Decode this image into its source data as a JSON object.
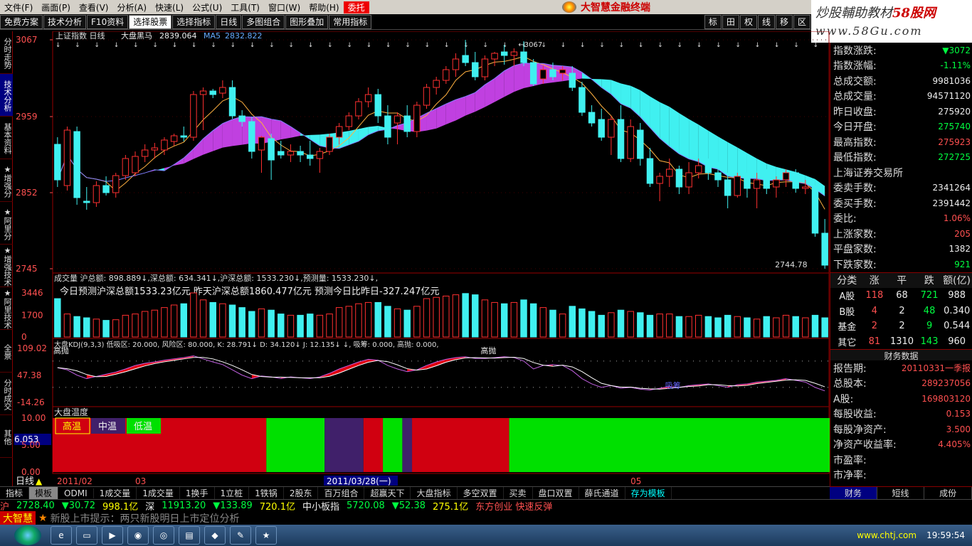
{
  "menu": [
    "文件(F)",
    "画面(P)",
    "查看(V)",
    "分析(A)",
    "快速(L)",
    "公式(U)",
    "工具(T)",
    "窗口(W)",
    "帮助(H)",
    "委托"
  ],
  "brand": "大智慧金融终端",
  "watermark": {
    "line1_prefix": "炒股輔助教材",
    "line1_accent": "58股网",
    "line2": "www.58Gu.com"
  },
  "toolbar": [
    "免费方案",
    "技术分析",
    "F10资料",
    "选择股票",
    "选择指标",
    "日线",
    "多图组合",
    "图形叠加",
    "常用指标",
    "标",
    "田",
    "权",
    "线",
    "移",
    "区"
  ],
  "side_tabs": [
    "分时走势",
    "技术分析",
    "基本资料",
    "★增强分",
    "★阿里分",
    "★增强技术",
    "★阿里技术",
    "全景",
    "分时成交",
    "其他"
  ],
  "main_chart": {
    "title": "上证指数 日线",
    "indicator": "大盘黑马",
    "indicator_value": "2839.064",
    "ma_label": "MA5",
    "ma_value": "2832.822",
    "y_ticks": [
      "3067",
      "2959",
      "2852",
      "2745"
    ],
    "low_mark": "2744.78",
    "high_mark": "3067"
  },
  "volume_panel": {
    "header": "成交量 沪总额: 898.889↓,深总额: 634.341↓,沪深总额: 1533.230↓,预测量: 1533.230↓,",
    "forecast": "今日预测沪深总额1533.23亿元  昨天沪深总额1860.477亿元  预测今日比昨日-327.247亿元",
    "y_ticks": [
      "3446",
      "1700",
      "0"
    ]
  },
  "kdj_panel": {
    "header": "大盘KDJ(9,3,3)  低吸区: 20.000, 风险区: 80.000, K: 28.791↓ D: 34.120↓ J: 12.135↓  ↓,  吸筹: 0.000, 高抛: 0.000,",
    "y_ticks": [
      "109.02",
      "47.38",
      "-14.26"
    ],
    "labels": [
      "高抛",
      "高抛",
      "吸筹"
    ]
  },
  "temp_panel": {
    "title": "大盘温度",
    "legend": [
      "高温",
      "中温",
      "低温"
    ],
    "y_ticks": [
      "10.00",
      "6.053",
      "5.00",
      "0.00"
    ]
  },
  "date_axis": {
    "left": "2011/02",
    "m3": "03",
    "cursor": "2011/03/28(一)",
    "m5": "05"
  },
  "period_label": "日线",
  "right_panel": [
    {
      "k": "指数涨跌:",
      "v": "▼3072",
      "c": "grn"
    },
    {
      "k": "指数涨幅:",
      "v": "-1.11%",
      "c": "grn"
    },
    {
      "k": "总成交额:",
      "v": "9981036",
      "c": "wht"
    },
    {
      "k": "总成交量:",
      "v": "94571120",
      "c": "wht"
    },
    {
      "k": "昨日收盘:",
      "v": "275920",
      "c": "wht"
    },
    {
      "k": "今日开盘:",
      "v": "275740",
      "c": "grn"
    },
    {
      "k": "最高指数:",
      "v": "275923",
      "c": "red"
    },
    {
      "k": "最低指数:",
      "v": "272725",
      "c": "grn"
    },
    {
      "k": "上海证券交易所",
      "v": "",
      "c": "wht"
    },
    {
      "k": "委卖手数:",
      "v": "2341264",
      "c": "wht"
    },
    {
      "k": "委买手数:",
      "v": "2391442",
      "c": "wht"
    },
    {
      "k": "委比:",
      "v": "1.06%",
      "c": "red"
    },
    {
      "k": "上涨家数:",
      "v": "205",
      "c": "red"
    },
    {
      "k": "平盘家数:",
      "v": "1382",
      "c": "wht"
    },
    {
      "k": "下跌家数:",
      "v": "921",
      "c": "grn"
    }
  ],
  "class_table": {
    "headers": [
      "分类",
      "涨",
      "平",
      "跌",
      "额(亿)"
    ],
    "rows": [
      [
        "A股",
        "118",
        "68",
        "721",
        "988"
      ],
      [
        "B股",
        "4",
        "2",
        "48",
        "0.340"
      ],
      [
        "基金",
        "2",
        "2",
        "9",
        "0.544"
      ],
      [
        "其它",
        "81",
        "1310",
        "143",
        "960"
      ]
    ]
  },
  "finance": {
    "title": "财务数据",
    "rows": [
      {
        "k": "报告期:",
        "v": "20110331一季报",
        "c": "red"
      },
      {
        "k": "总股本:",
        "v": "289237056",
        "c": "red"
      },
      {
        "k": "A股:",
        "v": "169803120",
        "c": "red"
      },
      {
        "k": "每股收益:",
        "v": "0.153",
        "c": "red"
      },
      {
        "k": "每股净资产:",
        "v": "3.500",
        "c": "red"
      },
      {
        "k": "净资产收益率:",
        "v": "4.405%",
        "c": "red"
      },
      {
        "k": "市盈率:",
        "v": "",
        "c": "wht"
      },
      {
        "k": "市净率:",
        "v": "",
        "c": "wht"
      }
    ]
  },
  "right_tabs": [
    "财务",
    "短线",
    "成份"
  ],
  "bottom_tabs": [
    "指标",
    "模板",
    "ODMI",
    "1成交量",
    "1成交量",
    "1换手",
    "1立桩",
    "1铁锅",
    "2股东",
    "百万组合",
    "超赢天下",
    "大盘指标",
    "多空双置",
    "买卖",
    "盘口双置",
    "薛氏通道",
    "存为模板"
  ],
  "ticker": {
    "sh_label": "沪",
    "sh_val": "2728.40",
    "sh_chg": "▼30.72",
    "sh_amt": "998.1亿",
    "sz_label": "深",
    "sz_val": "11913.20",
    "sz_chg": "▼133.89",
    "sz_amt": "720.1亿",
    "zxb_label": "中小板指",
    "zxb_val": "5720.08",
    "zxb_chg": "▼52.38",
    "zxb_amt": "275.1亿",
    "promo": "东方创业 快速反弹"
  },
  "news": {
    "app": "大智慧",
    "text": "新股上市提示：两只新股明日上市定位分析"
  },
  "taskbar": {
    "time": "19:59:54",
    "site": "www.chtj.com"
  },
  "colors": {
    "up": "#ff3030",
    "down": "#40f0f0",
    "ma_up": "#c040e0",
    "band_down": "#40f0f0",
    "hot": "#d00010",
    "warm": "#40206a",
    "cold": "#00e000"
  },
  "chart_data": {
    "type": "candlestick",
    "title": "上证指数 日线",
    "ylim": [
      2745,
      3067
    ],
    "ohlc": [
      [
        2920,
        2930,
        2860,
        2870
      ],
      [
        2862,
        2945,
        2855,
        2940
      ],
      [
        2938,
        2945,
        2835,
        2845
      ],
      [
        2840,
        2860,
        2828,
        2838
      ],
      [
        2838,
        2868,
        2832,
        2862
      ],
      [
        2862,
        2875,
        2848,
        2852
      ],
      [
        2852,
        2880,
        2845,
        2876
      ],
      [
        2876,
        2905,
        2870,
        2900
      ],
      [
        2880,
        2910,
        2875,
        2903
      ],
      [
        2903,
        2920,
        2895,
        2912
      ],
      [
        2912,
        2922,
        2900,
        2915
      ],
      [
        2912,
        2930,
        2905,
        2926
      ],
      [
        2924,
        2935,
        2918,
        2932
      ],
      [
        2932,
        2945,
        2924,
        2930
      ],
      [
        2930,
        2995,
        2925,
        2990
      ],
      [
        2990,
        3000,
        2940,
        2995
      ],
      [
        2995,
        2998,
        2985,
        2990
      ],
      [
        2992,
        3010,
        2985,
        3000
      ],
      [
        3000,
        3010,
        2956,
        2960
      ],
      [
        2960,
        2968,
        2945,
        2952
      ],
      [
        2952,
        2958,
        2900,
        2910
      ],
      [
        2912,
        2932,
        2880,
        2930
      ],
      [
        2928,
        2935,
        2870,
        2898
      ],
      [
        2910,
        2925,
        2900,
        2905
      ],
      [
        2905,
        2920,
        2895,
        2910
      ],
      [
        2910,
        2918,
        2895,
        2905
      ],
      [
        2905,
        2925,
        2890,
        2900
      ],
      [
        2900,
        2915,
        2880,
        2910
      ],
      [
        2910,
        2935,
        2905,
        2930
      ],
      [
        2930,
        2950,
        2920,
        2945
      ],
      [
        2945,
        2965,
        2940,
        2960
      ],
      [
        2960,
        2985,
        2955,
        2980
      ],
      [
        2980,
        3000,
        2972,
        2990
      ],
      [
        2990,
        2998,
        2950,
        2960
      ],
      [
        2960,
        2975,
        2920,
        2930
      ],
      [
        2950,
        2965,
        2920,
        2960
      ],
      [
        2960,
        2975,
        2930,
        2938
      ],
      [
        2938,
        2980,
        2930,
        2975
      ],
      [
        2975,
        3005,
        2970,
        3000
      ],
      [
        3000,
        3015,
        2990,
        3010
      ],
      [
        3010,
        3030,
        3005,
        3025
      ],
      [
        3025,
        3048,
        3015,
        3040
      ],
      [
        3045,
        3067,
        3030,
        3035
      ],
      [
        3035,
        3050,
        3010,
        3015
      ],
      [
        3015,
        3045,
        3010,
        3040
      ],
      [
        3040,
        3050,
        3030,
        3048
      ],
      [
        3050,
        3060,
        3032,
        3045
      ],
      [
        3045,
        3055,
        3030,
        3050
      ],
      [
        3050,
        3065,
        3030,
        3035
      ],
      [
        3035,
        3040,
        3002,
        3005
      ],
      [
        3012,
        3030,
        3005,
        3025
      ],
      [
        3025,
        3035,
        3010,
        3015
      ],
      [
        3020,
        3030,
        3010,
        3025
      ],
      [
        3020,
        3030,
        2995,
        3000
      ],
      [
        3000,
        3008,
        2960,
        2965
      ],
      [
        2965,
        2975,
        2945,
        2950
      ],
      [
        2955,
        2970,
        2925,
        2930
      ],
      [
        2930,
        2960,
        2905,
        2955
      ],
      [
        2955,
        2975,
        2895,
        2900
      ],
      [
        2900,
        2955,
        2895,
        2945
      ],
      [
        2940,
        2950,
        2890,
        2900
      ],
      [
        2900,
        2915,
        2860,
        2865
      ],
      [
        2865,
        2880,
        2840,
        2875
      ],
      [
        2875,
        2900,
        2860,
        2885
      ],
      [
        2885,
        2890,
        2850,
        2860
      ],
      [
        2860,
        2895,
        2850,
        2880
      ],
      [
        2880,
        2900,
        2872,
        2890
      ],
      [
        2890,
        2900,
        2870,
        2880
      ],
      [
        2880,
        2895,
        2860,
        2870
      ],
      [
        2870,
        2880,
        2830,
        2848
      ],
      [
        2848,
        2880,
        2845,
        2875
      ],
      [
        2875,
        2880,
        2845,
        2858
      ],
      [
        2858,
        2880,
        2830,
        2870
      ],
      [
        2870,
        2885,
        2850,
        2858
      ],
      [
        2860,
        2875,
        2845,
        2870
      ],
      [
        2870,
        2885,
        2860,
        2880
      ],
      [
        2880,
        2885,
        2852,
        2858
      ],
      [
        2858,
        2870,
        2850,
        2860
      ],
      [
        2860,
        2862,
        2790,
        2795
      ],
      [
        2795,
        2815,
        2745,
        2750
      ]
    ],
    "volume": [
      3000,
      1800,
      1600,
      1500,
      1400,
      1300,
      1350,
      1700,
      1800,
      2000,
      2100,
      2300,
      2500,
      2600,
      3446,
      2900,
      2700,
      2600,
      2500,
      2300,
      2000,
      2200,
      2100,
      1800,
      1700,
      1700,
      1800,
      1700,
      1800,
      2300,
      2400,
      2600,
      2700,
      2700,
      2400,
      2200,
      2100,
      2400,
      3000,
      3100,
      3200,
      3300,
      3400,
      3300,
      2900,
      2700,
      2600,
      2700,
      2900,
      2600,
      2300,
      2100,
      1800,
      2400,
      2200,
      2000,
      1700,
      1900,
      2100,
      2000,
      1900,
      1700,
      1800,
      1800,
      1600,
      1600,
      1700,
      1600,
      1500,
      1700,
      1600,
      1500,
      1400,
      1600,
      1500,
      1700,
      1600,
      1500,
      1700,
      1500
    ],
    "k": [
      65,
      60,
      48,
      40,
      45,
      50,
      55,
      62,
      70,
      75,
      78,
      82,
      85,
      88,
      92,
      85,
      78,
      72,
      60,
      48,
      40,
      46,
      44,
      40,
      44,
      42,
      40,
      44,
      52,
      62,
      70,
      78,
      84,
      82,
      70,
      62,
      56,
      60,
      70,
      78,
      84,
      88,
      90,
      86,
      86,
      88,
      90,
      88,
      80,
      62,
      70,
      72,
      70,
      58,
      40,
      28,
      20,
      24,
      18,
      20,
      16,
      14,
      18,
      22,
      20,
      24,
      26,
      28,
      24,
      20,
      26,
      28,
      32,
      34,
      36,
      40,
      36,
      32,
      20,
      12
    ],
    "temperature_zones": [
      {
        "from": 0,
        "to": 22,
        "level": "高温"
      },
      {
        "from": 22,
        "to": 28,
        "level": "低温"
      },
      {
        "from": 28,
        "to": 32,
        "level": "中温"
      },
      {
        "from": 32,
        "to": 34,
        "level": "高温"
      },
      {
        "from": 34,
        "to": 36,
        "level": "低温"
      },
      {
        "from": 36,
        "to": 37,
        "level": "中温"
      },
      {
        "from": 37,
        "to": 47,
        "level": "高温"
      },
      {
        "from": 47,
        "to": 80,
        "level": "低温"
      }
    ]
  }
}
